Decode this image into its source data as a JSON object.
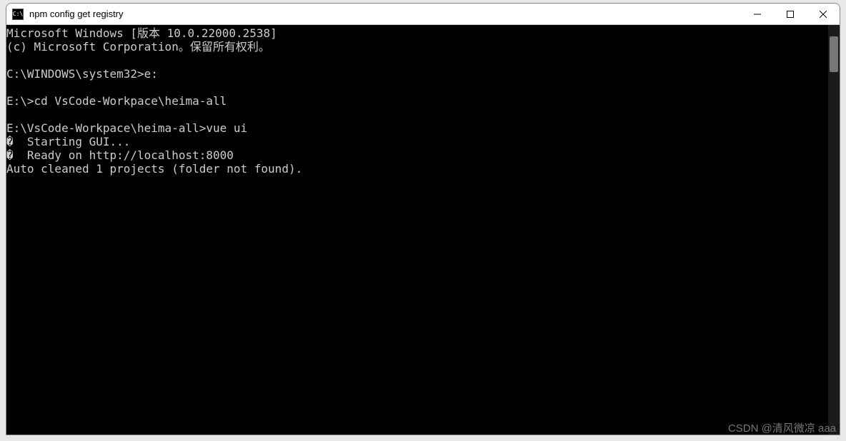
{
  "titlebar": {
    "icon_text": "C:\\",
    "title": "npm config get registry"
  },
  "terminal": {
    "lines": [
      "Microsoft Windows [版本 10.0.22000.2538]",
      "(c) Microsoft Corporation。保留所有权利。",
      "",
      "C:\\WINDOWS\\system32>e:",
      "",
      "E:\\>cd VsCode-Workpace\\heima-all",
      "",
      "E:\\VsCode-Workpace\\heima-all>vue ui",
      "�  Starting GUI...",
      "�  Ready on http://localhost:8000",
      "Auto cleaned 1 projects (folder not found)."
    ]
  },
  "watermark": "CSDN @清风微凉 aaa"
}
